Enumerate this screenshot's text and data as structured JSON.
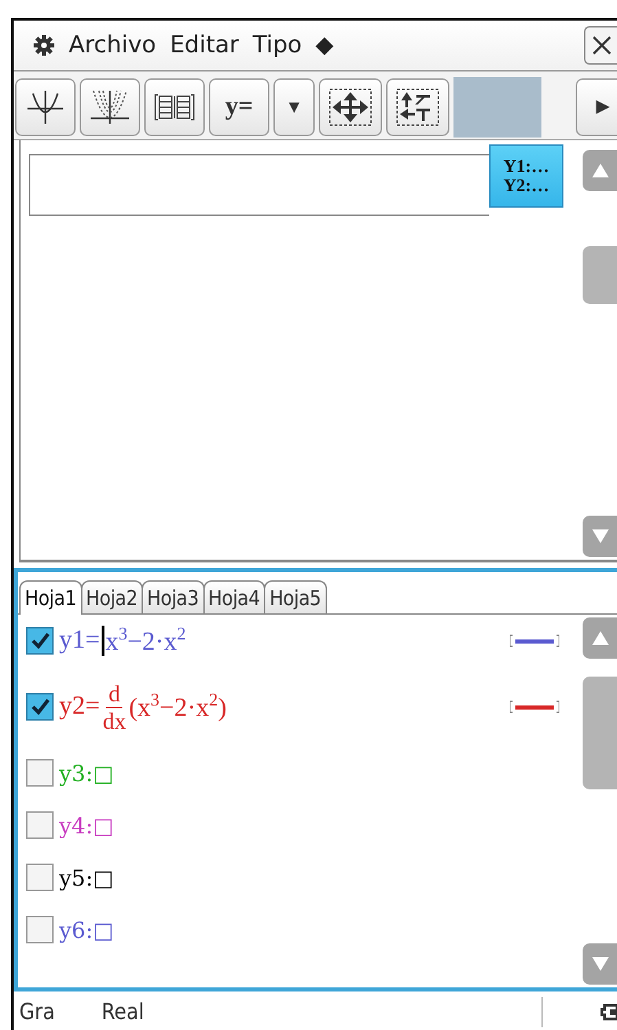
{
  "menu": {
    "items": [
      "Archivo",
      "Editar",
      "Tipo",
      "◆"
    ]
  },
  "toolbar": {
    "buttons": [
      {
        "kind": "graph"
      },
      {
        "kind": "family"
      },
      {
        "kind": "table"
      },
      {
        "kind": "text",
        "label": "y="
      },
      {
        "kind": "text",
        "label": "▼"
      },
      {
        "kind": "pan"
      },
      {
        "kind": "swap"
      },
      {
        "kind": "spacer"
      },
      {
        "kind": "text",
        "label": "▶"
      }
    ]
  },
  "graph": {
    "legend": [
      "Y1:…",
      "Y2:…"
    ]
  },
  "editor": {
    "tabs": [
      {
        "label": "Hoja1",
        "selected": true
      },
      {
        "label": "Hoja2",
        "selected": false
      },
      {
        "label": "Hoja3",
        "selected": false
      },
      {
        "label": "Hoja4",
        "selected": false
      },
      {
        "label": "Hoja5",
        "selected": false
      }
    ],
    "rows": [
      {
        "kind": "expression",
        "checked": true,
        "color": "#5a5ad0",
        "name": "y1=",
        "expr": "x$^{3}$−2·x$^{2}$",
        "cursor": true
      },
      {
        "kind": "derivative",
        "checked": true,
        "color": "#d82828",
        "name": "y2=",
        "numerator": "d",
        "denominator": "dx",
        "expr": "(x$^{3}$−2·x$^{2}$)",
        "cursor": false
      },
      {
        "kind": "empty",
        "checked": false,
        "color": "#22b022",
        "name": "y3:□",
        "cursor": false
      },
      {
        "kind": "empty",
        "checked": false,
        "color": "#c83cc0",
        "name": "y4:□",
        "cursor": false
      },
      {
        "kind": "empty",
        "checked": false,
        "color": "#000000",
        "name": "y5:□",
        "cursor": false
      },
      {
        "kind": "empty",
        "checked": false,
        "color": "#5a5ad0",
        "name": "y6:□",
        "cursor": false
      }
    ]
  },
  "status": {
    "mode": "Gra",
    "number_format": "Real"
  }
}
